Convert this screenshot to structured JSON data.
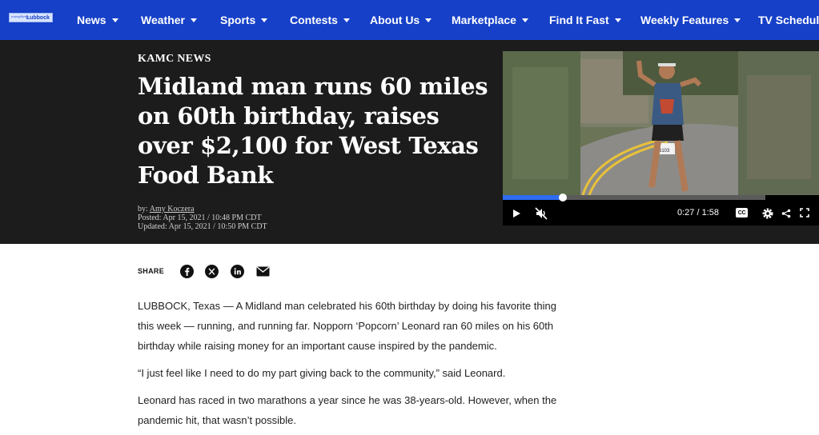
{
  "nav": {
    "logo": {
      "small": "everything",
      "main": "Lubbock"
    },
    "items": [
      {
        "label": "News"
      },
      {
        "label": "Weather"
      },
      {
        "label": "Sports"
      },
      {
        "label": "Contests"
      },
      {
        "label": "About Us"
      },
      {
        "label": "Marketplace"
      },
      {
        "label": "Find It Fast"
      },
      {
        "label": "Weekly Features"
      },
      {
        "label": "TV Schedule"
      }
    ]
  },
  "article": {
    "kicker": "KAMC NEWS",
    "headline": "Midland man runs 60 miles on 60th birthday, raises over $2,100 for West Texas Food Bank",
    "byline": {
      "prefix": "by:",
      "author": "Amy Koczera",
      "posted": "Posted: Apr 15, 2021 / 10:48 PM CDT",
      "updated": "Updated: Apr 15, 2021 / 10:50 PM CDT"
    }
  },
  "video": {
    "current_time": "0:27",
    "duration": "/ 1:58",
    "progress": 0.23,
    "bib_number": "6103",
    "cc_label": "CC"
  },
  "share": {
    "label": "SHARE",
    "icons": [
      "facebook-icon",
      "x-icon",
      "linkedin-icon",
      "email-icon"
    ]
  },
  "body": {
    "paragraphs": [
      "LUBBOCK, Texas — A Midland man celebrated his 60th birthday by doing his favorite thing this week — running, and running far. Nopporn ‘Popcorn’ Leonard ran 60 miles on his 60th birthday while raising money for an important cause inspired by the pandemic.",
      "“I just feel like I need to do my part giving back to the community,” said Leonard.",
      "Leonard has raced in two marathons a year since he was 38-years-old. However, when the pandemic hit, that wasn’t possible."
    ]
  },
  "colors": {
    "nav_bg": "#1640c8",
    "hero_bg": "#1c1c1c",
    "progress": "#2e6cf0"
  }
}
